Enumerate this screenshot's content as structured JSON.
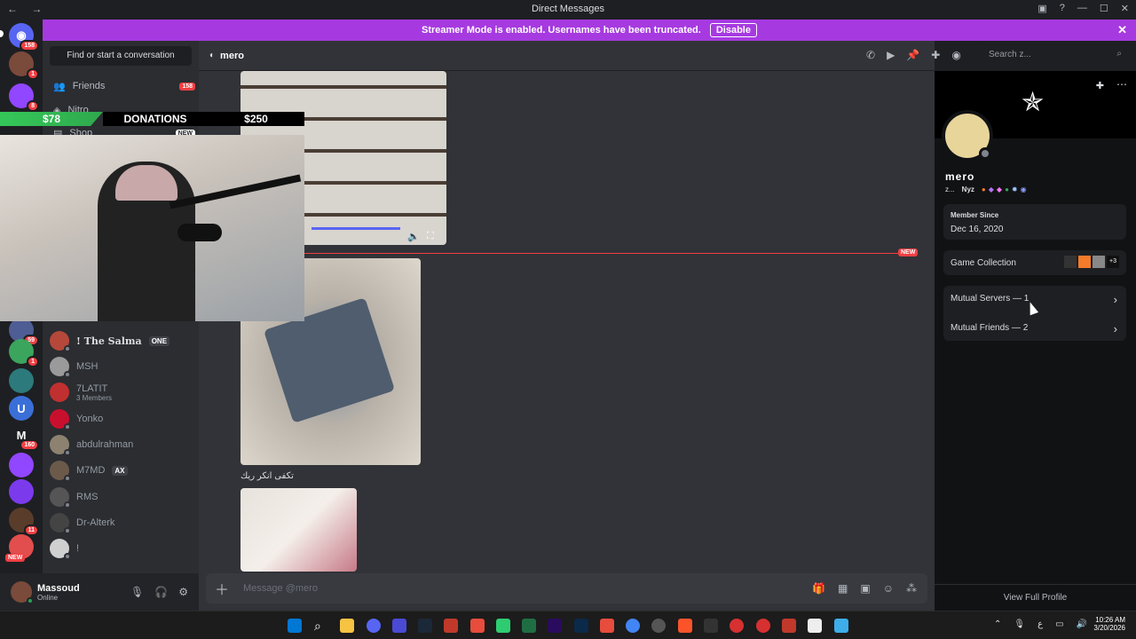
{
  "window": {
    "title": "Direct Messages",
    "nav": "← →"
  },
  "streamer_banner": {
    "text": "Streamer Mode is enabled. Usernames have been truncated.",
    "button": "Disable"
  },
  "guilds": [
    {
      "label": "",
      "badge": "158",
      "color": "#5865f2"
    },
    {
      "label": "",
      "badge": "1",
      "color": "#7a4a3a"
    },
    {
      "label": "",
      "badge": "8",
      "color": "#9146ff"
    },
    {
      "label": "",
      "badge": "59",
      "color": "#4e5d94"
    },
    {
      "label": "",
      "badge": "1",
      "color": "#3ba55d"
    },
    {
      "label": "",
      "badge": "",
      "color": "#2c7a7b"
    },
    {
      "label": "U",
      "badge": "",
      "color": "#3b6fd8"
    },
    {
      "label": "M",
      "badge": "160",
      "color": "#1e1f22"
    },
    {
      "label": "",
      "badge": "",
      "color": "#9146ff"
    },
    {
      "label": "",
      "badge": "",
      "color": "#7c3aed"
    },
    {
      "label": "",
      "badge": "11",
      "color": "#5a3c2a"
    },
    {
      "label": "",
      "badge": "",
      "color": "#e24d4d"
    }
  ],
  "guild_new": "NEW",
  "dm_sidebar": {
    "find": "Find or start a conversation",
    "friends": "Friends",
    "friends_badge": "158",
    "nitro": "Nitro",
    "shop": "Shop",
    "shop_badge": "NEW",
    "items": [
      {
        "name": "! The Salma",
        "chip": "ONE",
        "sub": ""
      },
      {
        "name": "MSH",
        "chip": "",
        "sub": ""
      },
      {
        "name": "7LATIT",
        "chip": "",
        "sub": "3 Members"
      },
      {
        "name": "Yonko",
        "chip": "",
        "sub": ""
      },
      {
        "name": "abdulrahman",
        "chip": "",
        "sub": ""
      },
      {
        "name": "M7MD",
        "chip": "AX",
        "sub": ""
      },
      {
        "name": "RMS",
        "chip": "",
        "sub": ""
      },
      {
        "name": "Dr-Alterk",
        "chip": "",
        "sub": ""
      },
      {
        "name": "!",
        "chip": "",
        "sub": ""
      }
    ]
  },
  "user": {
    "name": "Massoud",
    "status": "Online"
  },
  "donations": {
    "left": "$78",
    "label": "DONATIONS",
    "right": "$250"
  },
  "chat": {
    "recipient": "mero",
    "new_divider": "NEW",
    "caption": "تكفى انكر ريك",
    "compose_placeholder": "Message @mero",
    "search_placeholder": "Search z..."
  },
  "profile": {
    "display_name": "mero",
    "tag_left": "z...",
    "tag_right": "Nyz",
    "member_since_label": "Member Since",
    "member_since": "Dec 16, 2020",
    "game_collection": "Game Collection",
    "game_more": "+3",
    "mutual_servers": "Mutual Servers — 1",
    "mutual_friends": "Mutual Friends — 2",
    "view_full": "View Full Profile"
  },
  "clock": {
    "time": "10:26 AM",
    "date": "3/20/2026",
    "lang": "ع"
  },
  "colors": {
    "blurple": "#5865f2",
    "streamer_purple": "#a63ae0",
    "danger": "#f23f43",
    "donation_green": "#35c759"
  }
}
